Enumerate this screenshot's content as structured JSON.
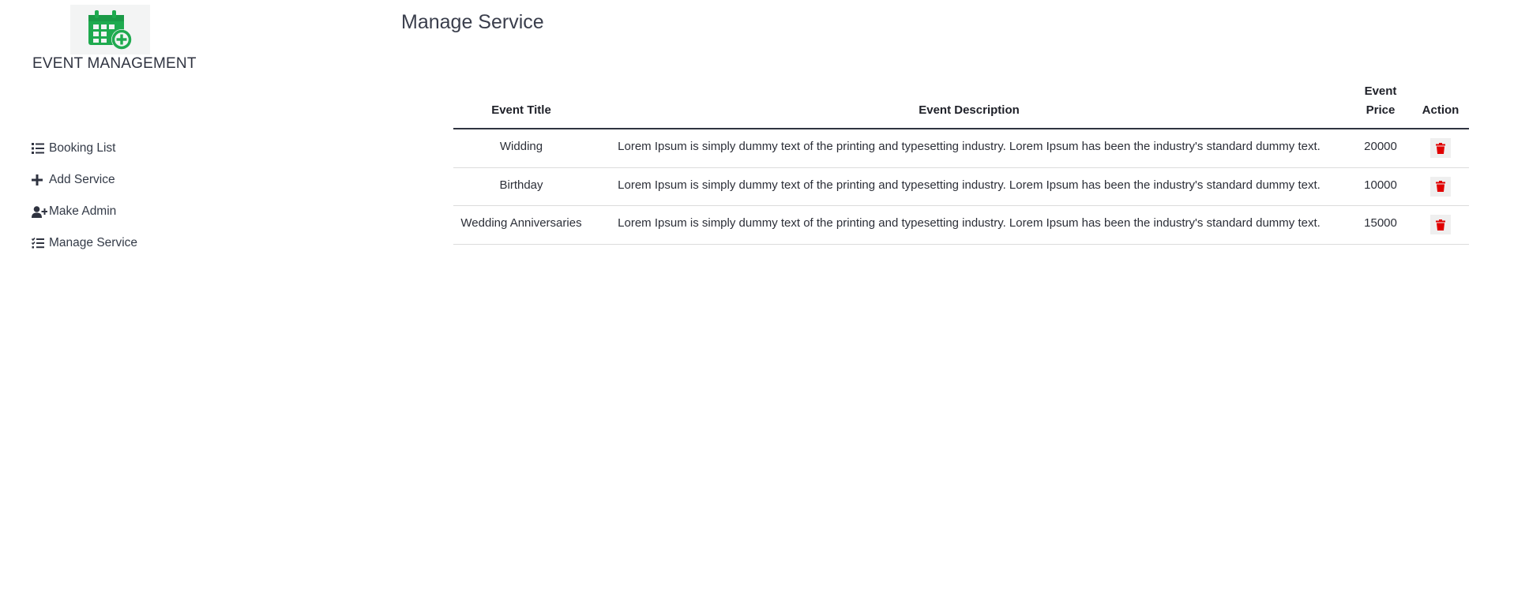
{
  "colors": {
    "brand_green": "#1faa4f",
    "delete_red": "#e00000"
  },
  "sidebar": {
    "brand": "EVENT MANAGEMENT",
    "logo_icon": "calendar-plus-icon",
    "items": [
      {
        "label": "Booking List",
        "icon": "list-icon"
      },
      {
        "label": "Add Service",
        "icon": "plus-icon"
      },
      {
        "label": "Make Admin",
        "icon": "user-plus-icon"
      },
      {
        "label": "Manage Service",
        "icon": "checklist-icon"
      }
    ]
  },
  "main": {
    "title": "Manage Service",
    "table": {
      "headers": {
        "title": "Event Title",
        "description": "Event Description",
        "price": "Event Price",
        "action": "Action"
      },
      "rows": [
        {
          "title": "Widding",
          "description": "Lorem Ipsum is simply dummy text of the printing and typesetting industry. Lorem Ipsum has been the industry's standard dummy text.",
          "price": "20000",
          "action_icon": "trash-icon"
        },
        {
          "title": "Birthday",
          "description": "Lorem Ipsum is simply dummy text of the printing and typesetting industry. Lorem Ipsum has been the industry's standard dummy text.",
          "price": "10000",
          "action_icon": "trash-icon"
        },
        {
          "title": "Wedding Anniversaries",
          "description": "Lorem Ipsum is simply dummy text of the printing and typesetting industry. Lorem Ipsum has been the industry's standard dummy text.",
          "price": "15000",
          "action_icon": "trash-icon"
        }
      ]
    }
  }
}
